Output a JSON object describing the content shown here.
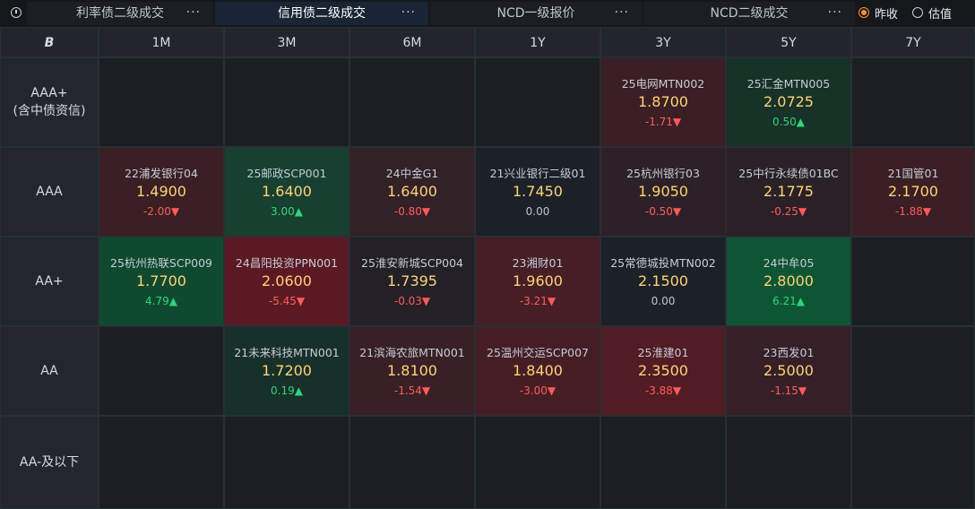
{
  "tabs": [
    {
      "label": "利率债二级成交",
      "more": "···",
      "active": false
    },
    {
      "label": "信用债二级成交",
      "more": "···",
      "active": true
    },
    {
      "label": "NCD一级报价",
      "more": "···",
      "active": false
    },
    {
      "label": "NCD二级成交",
      "more": "···",
      "active": false
    }
  ],
  "radios": [
    {
      "label": "昨收",
      "selected": true
    },
    {
      "label": "估值",
      "selected": false
    }
  ],
  "corner_icon": "B",
  "columns": [
    "1M",
    "3M",
    "6M",
    "1Y",
    "3Y",
    "5Y",
    "7Y"
  ],
  "rows": [
    {
      "label": "AAA+\n(含中债资信)",
      "cells": [
        null,
        null,
        null,
        null,
        {
          "name": "25电网MTN002",
          "yield": "1.8700",
          "change": "-1.71▼",
          "dir": "down",
          "bg": "#3a1f24"
        },
        {
          "name": "25汇金MTN005",
          "yield": "2.0725",
          "change": "0.50▲",
          "dir": "up",
          "bg": "#173227"
        },
        null
      ]
    },
    {
      "label": "AAA",
      "cells": [
        {
          "name": "22浦发银行04",
          "yield": "1.4900",
          "change": "-2.00▼",
          "dir": "down",
          "bg": "#3a1f24"
        },
        {
          "name": "25邮政SCP001",
          "yield": "1.6400",
          "change": "3.00▲",
          "dir": "up",
          "bg": "#174030"
        },
        {
          "name": "24中金G1",
          "yield": "1.6400",
          "change": "-0.80▼",
          "dir": "down",
          "bg": "#322126"
        },
        {
          "name": "21兴业银行二级01",
          "yield": "1.7450",
          "change": "0.00",
          "dir": "flat",
          "bg": "#1c2127"
        },
        {
          "name": "25杭州银行03",
          "yield": "1.9050",
          "change": "-0.50▼",
          "dir": "down",
          "bg": "#2d2127"
        },
        {
          "name": "25中行永续债01BC",
          "yield": "2.1775",
          "change": "-0.25▼",
          "dir": "down",
          "bg": "#2a2127"
        },
        {
          "name": "21国管01",
          "yield": "2.1700",
          "change": "-1.88▼",
          "dir": "down",
          "bg": "#3a1f24"
        }
      ]
    },
    {
      "label": "AA+",
      "cells": [
        {
          "name": "25杭州热联SCP009",
          "yield": "1.7700",
          "change": "4.79▲",
          "dir": "up",
          "bg": "#0f4a30"
        },
        {
          "name": "24昌阳投资PPN001",
          "yield": "2.0600",
          "change": "-5.45▼",
          "dir": "down",
          "bg": "#5b1a23"
        },
        {
          "name": "25淮安新城SCP004",
          "yield": "1.7395",
          "change": "-0.03▼",
          "dir": "down",
          "bg": "#232127"
        },
        {
          "name": "23湘财01",
          "yield": "1.9600",
          "change": "-3.21▼",
          "dir": "down",
          "bg": "#461e25"
        },
        {
          "name": "25常德城投MTN002",
          "yield": "2.1500",
          "change": "0.00",
          "dir": "flat",
          "bg": "#1c2127"
        },
        {
          "name": "24中牟05",
          "yield": "2.8000",
          "change": "6.21▲",
          "dir": "up",
          "bg": "#0e5534"
        },
        null
      ]
    },
    {
      "label": "AA",
      "cells": [
        null,
        {
          "name": "21未来科技MTN001",
          "yield": "1.7200",
          "change": "0.19▲",
          "dir": "up",
          "bg": "#18302a"
        },
        {
          "name": "21滨海农旅MTN001",
          "yield": "1.8100",
          "change": "-1.54▼",
          "dir": "down",
          "bg": "#382026"
        },
        {
          "name": "25温州交运SCP007",
          "yield": "1.8400",
          "change": "-3.00▼",
          "dir": "down",
          "bg": "#451e25"
        },
        {
          "name": "25淮建01",
          "yield": "2.3500",
          "change": "-3.88▼",
          "dir": "down",
          "bg": "#521c24"
        },
        {
          "name": "23西发01",
          "yield": "2.5000",
          "change": "-1.15▼",
          "dir": "down",
          "bg": "#352027"
        },
        null
      ]
    },
    {
      "label": "AA-及以下",
      "cells": [
        null,
        null,
        null,
        null,
        null,
        null,
        null
      ]
    }
  ]
}
